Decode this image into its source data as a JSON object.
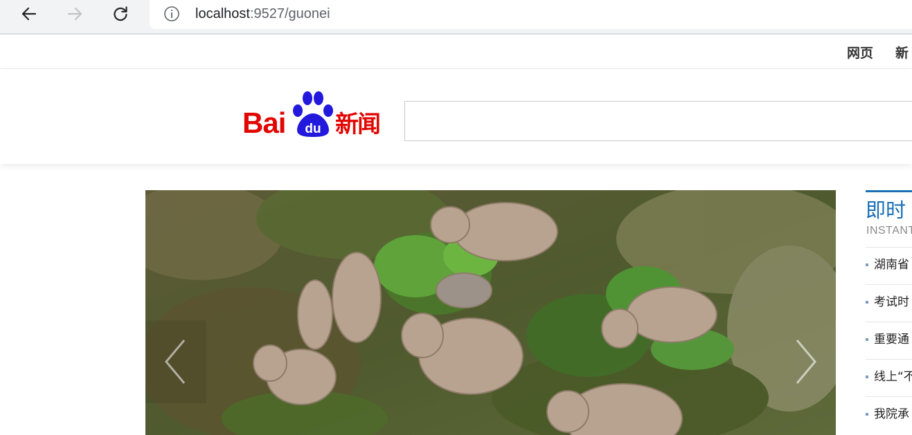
{
  "browser": {
    "url_host": "localhost",
    "url_rest": ":9527/guonei",
    "icons": [
      "back-arrow-icon",
      "forward-arrow-icon",
      "reload-icon",
      "info-icon"
    ]
  },
  "topnav": {
    "items": [
      "网页",
      "新"
    ]
  },
  "logo": {
    "bai": "Bai",
    "du": "du",
    "xinwen": "新闻"
  },
  "colors": {
    "brand_red": "#e10602",
    "paw_blue": "#2319dc",
    "accent_blue": "#1a6eb5"
  },
  "search": {
    "value": ""
  },
  "carousel": {
    "image_subject": "elephant herd in grassland",
    "prev_icon": "chevron-left-icon",
    "next_icon": "chevron-right-icon"
  },
  "instant_news": {
    "title": "即时",
    "subtitle": "INSTANT",
    "items": [
      "湖南省",
      "考试时",
      "重要通",
      "线上“不",
      "我院承"
    ]
  }
}
